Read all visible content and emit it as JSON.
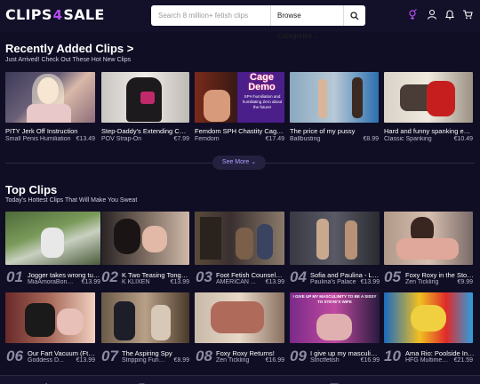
{
  "header": {
    "logo_left": "CLIPS",
    "logo_bolt": "4",
    "logo_right": "SALE",
    "search_placeholder": "Search 8 million+ fetish clips",
    "category_label": "Browse Categories",
    "icons": [
      "search-icon",
      "gender-icon",
      "user-icon",
      "bell-icon",
      "cart-icon"
    ]
  },
  "recent": {
    "title": "Recently Added Clips >",
    "subtitle": "Just Arrived! Check Out These Hot New Clips",
    "clips": [
      {
        "title": "PITY Jerk Off Instruction",
        "category": "Small Penis Humiliation",
        "price": "€13.49"
      },
      {
        "title": "Step-Daddy's Extending Cock ...",
        "category": "POV Strap-On",
        "price": "€7.99"
      },
      {
        "title": "Femdom SPH Chastity Cage ...",
        "category": "Femdom",
        "price": "€17.49",
        "overlay_title": "Cage Demo",
        "overlay_text": "SPH humiliation and humiliating Zero about the future!"
      },
      {
        "title": "The price of my pussy",
        "category": "Ballbusting",
        "price": "€8.99"
      },
      {
        "title": "Hard and funny spanking eac...",
        "category": "Classic Spanking",
        "price": "€10.49"
      }
    ],
    "see_more": "See More"
  },
  "top": {
    "title": "Top Clips",
    "subtitle": "Today's Hottest Clips That Will Make You Sweat",
    "clips": [
      {
        "rank": "01",
        "title": "Jogger takes wrong turn...",
        "category": "MiaAmoraBondage",
        "price": "€13.99"
      },
      {
        "rank": "02",
        "title": "K Two Teasing Tongue...",
        "category": "K KLIXEN",
        "price": "€13.99"
      },
      {
        "rank": "03",
        "title": "Foot Fetish Counselor...",
        "category": "AMERICAN ...",
        "price": "€13.99"
      },
      {
        "rank": "04",
        "title": "Sofia and Paulina - Le...",
        "category": "Paulina's Palace",
        "price": "€13.99"
      },
      {
        "rank": "05",
        "title": "Foxy Roxy in the Stocks",
        "category": "Zen Tickling",
        "price": "€9.99"
      },
      {
        "rank": "06",
        "title": "Our Fart Vacuum (Ft ...",
        "category": "Goddess D...",
        "price": "€13.99"
      },
      {
        "rank": "07",
        "title": "The Aspiring Spy",
        "category": "Stripping Fun & ...",
        "price": "€8.99"
      },
      {
        "rank": "08",
        "title": "Foxy Roxy Returns!",
        "category": "Zen Tickling",
        "price": "€16.99"
      },
      {
        "rank": "09",
        "title": "I give up my masculini...",
        "category": "Strictfetish",
        "price": "€16.99",
        "overlay_text": "I GIVE UP MY MASCULINITY TO BE A SISSY TO STEVE'S WIFE"
      },
      {
        "rank": "10",
        "title": "Ama Rio: Poolside Infl...",
        "category": "HFG Multimedia",
        "price": "€21.59"
      }
    ]
  },
  "colors": {
    "accent": "#b44cf0",
    "background": "#100e24",
    "link": "#a9a3ff"
  }
}
